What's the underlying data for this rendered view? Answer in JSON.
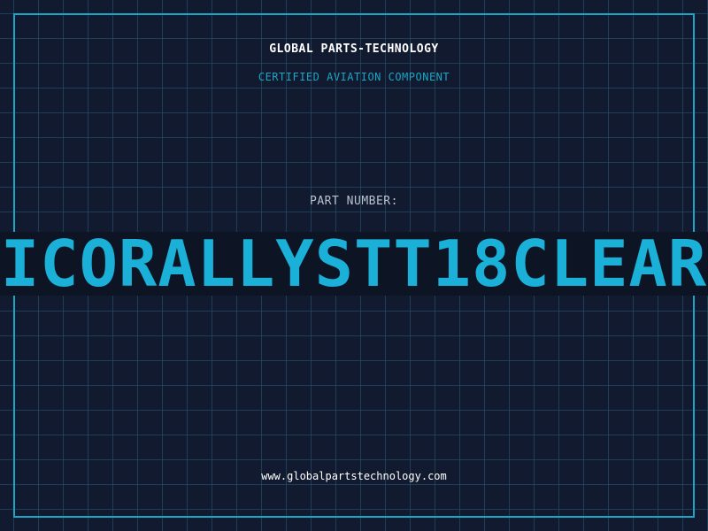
{
  "header": {
    "company": "GLOBAL PARTS-TECHNOLOGY",
    "tagline": "CERTIFIED AVIATION COMPONENT"
  },
  "part": {
    "label": "PART NUMBER:",
    "number": "ICORALLYSTT18CLEAR"
  },
  "footer": {
    "website": "www.globalpartstechnology.com"
  },
  "colors": {
    "background": "#111a2e",
    "accent": "#1aa6c8",
    "grid": "#285a78"
  }
}
